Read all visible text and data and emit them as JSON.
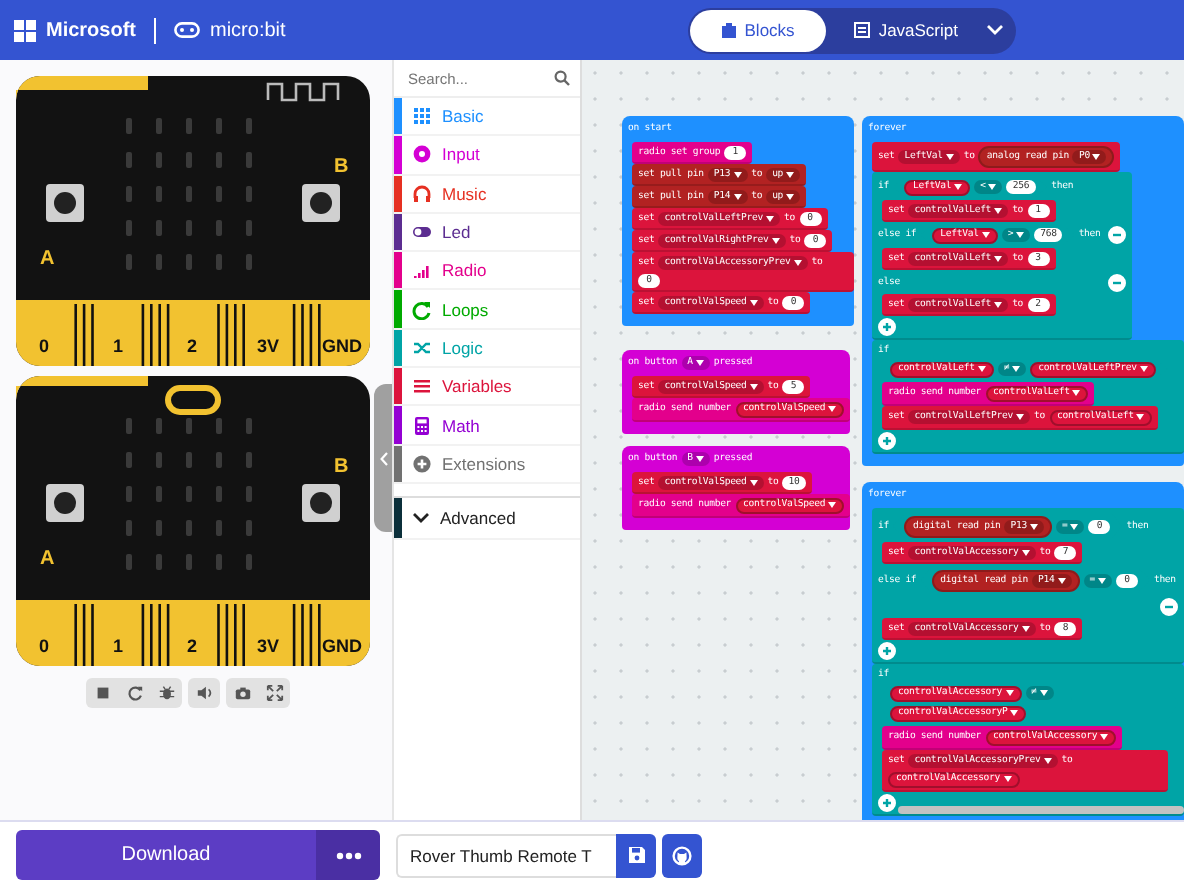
{
  "header": {
    "brand": "Microsoft",
    "product": "micro:bit",
    "tabs": [
      {
        "label": "Blocks",
        "selected": true
      },
      {
        "label": "JavaScript",
        "selected": false
      }
    ]
  },
  "simulator": {
    "boards": [
      {
        "button_labels": [
          "A",
          "B"
        ],
        "pins": [
          "0",
          "1",
          "2",
          "3V",
          "GND"
        ]
      },
      {
        "button_labels": [
          "A",
          "B"
        ],
        "pins": [
          "0",
          "1",
          "2",
          "3V",
          "GND"
        ]
      }
    ]
  },
  "toolbox": {
    "search": {
      "placeholder": "Search..."
    },
    "items": [
      {
        "kind": "category",
        "label": "Basic",
        "color": "#1e90ff",
        "selected": false
      },
      {
        "kind": "category",
        "label": "Input",
        "color": "#d400d4",
        "selected": false
      },
      {
        "kind": "category",
        "label": "Music",
        "color": "#e63022",
        "selected": false
      },
      {
        "kind": "category",
        "label": "Led",
        "color": "#5c2d91",
        "selected": false
      },
      {
        "kind": "category",
        "label": "Radio",
        "color": "#e3008c",
        "selected": false
      },
      {
        "kind": "category",
        "label": "Loops",
        "color": "#00aa00",
        "selected": false
      },
      {
        "kind": "category",
        "label": "Logic",
        "color": "#00a4a6",
        "selected": false
      },
      {
        "kind": "category",
        "label": "Variables",
        "color": "#dc143c",
        "selected": false
      },
      {
        "kind": "category",
        "label": "Math",
        "color": "#9400d3",
        "selected": false
      },
      {
        "kind": "category",
        "label": "Extensions",
        "color": "#717171",
        "selected": false
      },
      {
        "kind": "group",
        "label": "Advanced",
        "color": "#0b2f3a",
        "selected": false
      }
    ]
  },
  "workspace": {
    "stacks": [
      {
        "color": "#1e90ff",
        "tokens": [
          {
            "kind": "label",
            "text": "on start"
          }
        ],
        "body": [
          {
            "kind": "statement",
            "color": "#e3008c",
            "tokens": [
              {
                "kind": "label",
                "text": "radio set group"
              },
              {
                "kind": "number",
                "text": "1"
              }
            ]
          },
          {
            "kind": "statement",
            "color": "#b22222",
            "tokens": [
              {
                "kind": "label",
                "text": "set pull pin"
              },
              {
                "kind": "dropdown",
                "text": "P13"
              },
              {
                "kind": "label",
                "text": "to"
              },
              {
                "kind": "dropdown",
                "text": "up"
              }
            ]
          },
          {
            "kind": "statement",
            "color": "#b22222",
            "tokens": [
              {
                "kind": "label",
                "text": "set pull pin"
              },
              {
                "kind": "dropdown",
                "text": "P14"
              },
              {
                "kind": "label",
                "text": "to"
              },
              {
                "kind": "dropdown",
                "text": "up"
              }
            ]
          },
          {
            "kind": "statement",
            "color": "#dc143c",
            "tokens": [
              {
                "kind": "label",
                "text": "set"
              },
              {
                "kind": "dropdown",
                "text": "controlValLeftPrev"
              },
              {
                "kind": "label",
                "text": "to"
              },
              {
                "kind": "number",
                "text": "0"
              }
            ]
          },
          {
            "kind": "statement",
            "color": "#dc143c",
            "tokens": [
              {
                "kind": "label",
                "text": "set"
              },
              {
                "kind": "dropdown",
                "text": "controlValRightPrev"
              },
              {
                "kind": "label",
                "text": "to"
              },
              {
                "kind": "number",
                "text": "0"
              }
            ]
          },
          {
            "kind": "statement",
            "color": "#dc143c",
            "tokens": [
              {
                "kind": "label",
                "text": "set"
              },
              {
                "kind": "dropdown",
                "text": "controlValAccessoryPrev"
              },
              {
                "kind": "label",
                "text": "to"
              },
              {
                "kind": "number",
                "text": "0"
              }
            ]
          },
          {
            "kind": "statement",
            "color": "#dc143c",
            "tokens": [
              {
                "kind": "label",
                "text": "set"
              },
              {
                "kind": "dropdown",
                "text": "controlValSpeed"
              },
              {
                "kind": "label",
                "text": "to"
              },
              {
                "kind": "number",
                "text": "0"
              }
            ]
          }
        ]
      },
      {
        "color": "#d400d4",
        "tokens": [
          {
            "kind": "label",
            "text": "on button"
          },
          {
            "kind": "dropdown",
            "text": "A"
          },
          {
            "kind": "label",
            "text": "pressed"
          }
        ],
        "body": [
          {
            "kind": "statement",
            "color": "#dc143c",
            "tokens": [
              {
                "kind": "label",
                "text": "set"
              },
              {
                "kind": "dropdown",
                "text": "controlValSpeed"
              },
              {
                "kind": "label",
                "text": "to"
              },
              {
                "kind": "number",
                "text": "5"
              }
            ]
          },
          {
            "kind": "statement",
            "color": "#e3008c",
            "tokens": [
              {
                "kind": "label",
                "text": "radio send number"
              },
              {
                "kind": "variable",
                "text": "controlValSpeed"
              }
            ]
          }
        ]
      },
      {
        "color": "#d400d4",
        "tokens": [
          {
            "kind": "label",
            "text": "on button"
          },
          {
            "kind": "dropdown",
            "text": "B"
          },
          {
            "kind": "label",
            "text": "pressed"
          }
        ],
        "body": [
          {
            "kind": "statement",
            "color": "#dc143c",
            "tokens": [
              {
                "kind": "label",
                "text": "set"
              },
              {
                "kind": "dropdown",
                "text": "controlValSpeed"
              },
              {
                "kind": "label",
                "text": "to"
              },
              {
                "kind": "number",
                "text": "10"
              }
            ]
          },
          {
            "kind": "statement",
            "color": "#e3008c",
            "tokens": [
              {
                "kind": "label",
                "text": "radio send number"
              },
              {
                "kind": "variable",
                "text": "controlValSpeed"
              }
            ]
          }
        ]
      },
      {
        "color": "#1e90ff",
        "tokens": [
          {
            "kind": "label",
            "text": "forever"
          }
        ],
        "body": [
          {
            "kind": "statement",
            "color": "#dc143c",
            "tokens": [
              {
                "kind": "label",
                "text": "set"
              },
              {
                "kind": "dropdown",
                "text": "LeftVal"
              },
              {
                "kind": "label",
                "text": "to"
              },
              {
                "kind": "reporter",
                "color": "#b22222",
                "tokens": [
                  {
                    "kind": "label",
                    "text": "analog read pin"
                  },
                  {
                    "kind": "dropdown",
                    "text": "P0"
                  }
                ]
              }
            ]
          },
          {
            "kind": "if",
            "color": "#00a4a6",
            "branches": [
              {
                "kind": "if",
                "tokens": [
                  {
                    "kind": "label",
                    "text": "if"
                  },
                  {
                    "kind": "boolean",
                    "color": "#00a4a6",
                    "tokens": [
                      {
                        "kind": "variable",
                        "text": "LeftVal"
                      },
                      {
                        "kind": "dropdown",
                        "text": "<"
                      },
                      {
                        "kind": "number",
                        "text": "256"
                      }
                    ]
                  },
                  {
                    "kind": "label",
                    "text": "then"
                  }
                ],
                "body": [
                  {
                    "kind": "statement",
                    "color": "#dc143c",
                    "tokens": [
                      {
                        "kind": "label",
                        "text": "set"
                      },
                      {
                        "kind": "dropdown",
                        "text": "controlValLeft"
                      },
                      {
                        "kind": "label",
                        "text": "to"
                      },
                      {
                        "kind": "number",
                        "text": "1"
                      }
                    ]
                  }
                ]
              },
              {
                "kind": "else_if",
                "tokens": [
                  {
                    "kind": "label",
                    "text": "else if"
                  },
                  {
                    "kind": "boolean",
                    "color": "#00a4a6",
                    "tokens": [
                      {
                        "kind": "variable",
                        "text": "LeftVal"
                      },
                      {
                        "kind": "dropdown",
                        "text": ">"
                      },
                      {
                        "kind": "number",
                        "text": "768"
                      }
                    ]
                  },
                  {
                    "kind": "label",
                    "text": "then"
                  }
                ],
                "body": [
                  {
                    "kind": "statement",
                    "color": "#dc143c",
                    "tokens": [
                      {
                        "kind": "label",
                        "text": "set"
                      },
                      {
                        "kind": "dropdown",
                        "text": "controlValLeft"
                      },
                      {
                        "kind": "label",
                        "text": "to"
                      },
                      {
                        "kind": "number",
                        "text": "3"
                      }
                    ]
                  }
                ]
              },
              {
                "kind": "else",
                "tokens": [
                  {
                    "kind": "label",
                    "text": "else"
                  }
                ],
                "body": [
                  {
                    "kind": "statement",
                    "color": "#dc143c",
                    "tokens": [
                      {
                        "kind": "label",
                        "text": "set"
                      },
                      {
                        "kind": "dropdown",
                        "text": "controlValLeft"
                      },
                      {
                        "kind": "label",
                        "text": "to"
                      },
                      {
                        "kind": "number",
                        "text": "2"
                      }
                    ]
                  }
                ]
              }
            ]
          },
          {
            "kind": "if",
            "color": "#00a4a6",
            "branches": [
              {
                "kind": "if",
                "tokens": [
                  {
                    "kind": "label",
                    "text": "if"
                  },
                  {
                    "kind": "boolean",
                    "color": "#00a4a6",
                    "tokens": [
                      {
                        "kind": "variable",
                        "text": "controlValLeft"
                      },
                      {
                        "kind": "dropdown",
                        "text": "≠"
                      },
                      {
                        "kind": "variable",
                        "text": "controlValLeftPrev"
                      }
                    ]
                  }
                ],
                "body": [
                  {
                    "kind": "statement",
                    "color": "#e3008c",
                    "tokens": [
                      {
                        "kind": "label",
                        "text": "radio send number"
                      },
                      {
                        "kind": "variable",
                        "text": "controlValLeft"
                      }
                    ]
                  },
                  {
                    "kind": "statement",
                    "color": "#dc143c",
                    "tokens": [
                      {
                        "kind": "label",
                        "text": "set"
                      },
                      {
                        "kind": "dropdown",
                        "text": "controlValLeftPrev"
                      },
                      {
                        "kind": "label",
                        "text": "to"
                      },
                      {
                        "kind": "variable",
                        "text": "controlValLeft"
                      }
                    ]
                  }
                ]
              }
            ]
          }
        ]
      },
      {
        "color": "#1e90ff",
        "tokens": [
          {
            "kind": "label",
            "text": "forever"
          }
        ],
        "body": [
          {
            "kind": "if",
            "color": "#00a4a6",
            "branches": [
              {
                "kind": "if",
                "tokens": [
                  {
                    "kind": "label",
                    "text": "if"
                  },
                  {
                    "kind": "boolean",
                    "color": "#00a4a6",
                    "tokens": [
                      {
                        "kind": "reporter",
                        "color": "#b22222",
                        "tokens": [
                          {
                            "kind": "label",
                            "text": "digital read pin"
                          },
                          {
                            "kind": "dropdown",
                            "text": "P13"
                          }
                        ]
                      },
                      {
                        "kind": "dropdown",
                        "text": "="
                      },
                      {
                        "kind": "number",
                        "text": "0"
                      }
                    ]
                  },
                  {
                    "kind": "label",
                    "text": "then"
                  }
                ],
                "body": [
                  {
                    "kind": "statement",
                    "color": "#dc143c",
                    "tokens": [
                      {
                        "kind": "label",
                        "text": "set"
                      },
                      {
                        "kind": "dropdown",
                        "text": "controlValAccessory"
                      },
                      {
                        "kind": "label",
                        "text": "to"
                      },
                      {
                        "kind": "number",
                        "text": "7"
                      }
                    ]
                  }
                ]
              },
              {
                "kind": "else_if",
                "tokens": [
                  {
                    "kind": "label",
                    "text": "else if"
                  },
                  {
                    "kind": "boolean",
                    "color": "#00a4a6",
                    "tokens": [
                      {
                        "kind": "reporter",
                        "color": "#b22222",
                        "tokens": [
                          {
                            "kind": "label",
                            "text": "digital read pin"
                          },
                          {
                            "kind": "dropdown",
                            "text": "P14"
                          }
                        ]
                      },
                      {
                        "kind": "dropdown",
                        "text": "="
                      },
                      {
                        "kind": "number",
                        "text": "0"
                      }
                    ]
                  },
                  {
                    "kind": "label",
                    "text": "then"
                  }
                ],
                "body": [
                  {
                    "kind": "statement",
                    "color": "#dc143c",
                    "tokens": [
                      {
                        "kind": "label",
                        "text": "set"
                      },
                      {
                        "kind": "dropdown",
                        "text": "controlValAccessory"
                      },
                      {
                        "kind": "label",
                        "text": "to"
                      },
                      {
                        "kind": "number",
                        "text": "8"
                      }
                    ]
                  }
                ]
              }
            ]
          },
          {
            "kind": "if",
            "color": "#00a4a6",
            "branches": [
              {
                "kind": "if",
                "tokens": [
                  {
                    "kind": "label",
                    "text": "if"
                  },
                  {
                    "kind": "boolean",
                    "color": "#00a4a6",
                    "tokens": [
                      {
                        "kind": "variable",
                        "text": "controlValAccessory"
                      },
                      {
                        "kind": "dropdown",
                        "text": "≠"
                      },
                      {
                        "kind": "variable",
                        "text": "controlValAccessoryP"
                      }
                    ]
                  }
                ],
                "body": [
                  {
                    "kind": "statement",
                    "color": "#e3008c",
                    "tokens": [
                      {
                        "kind": "label",
                        "text": "radio send number"
                      },
                      {
                        "kind": "variable",
                        "text": "controlValAccessory"
                      }
                    ]
                  },
                  {
                    "kind": "statement",
                    "color": "#dc143c",
                    "tokens": [
                      {
                        "kind": "label",
                        "text": "set"
                      },
                      {
                        "kind": "dropdown",
                        "text": "controlValAccessoryPrev"
                      },
                      {
                        "kind": "label",
                        "text": "to"
                      },
                      {
                        "kind": "variable",
                        "text": "controlValAccessory"
                      }
                    ]
                  }
                ]
              }
            ]
          }
        ]
      }
    ]
  },
  "footer": {
    "download": "Download",
    "project_name": "Rover Thumb Remote T"
  }
}
